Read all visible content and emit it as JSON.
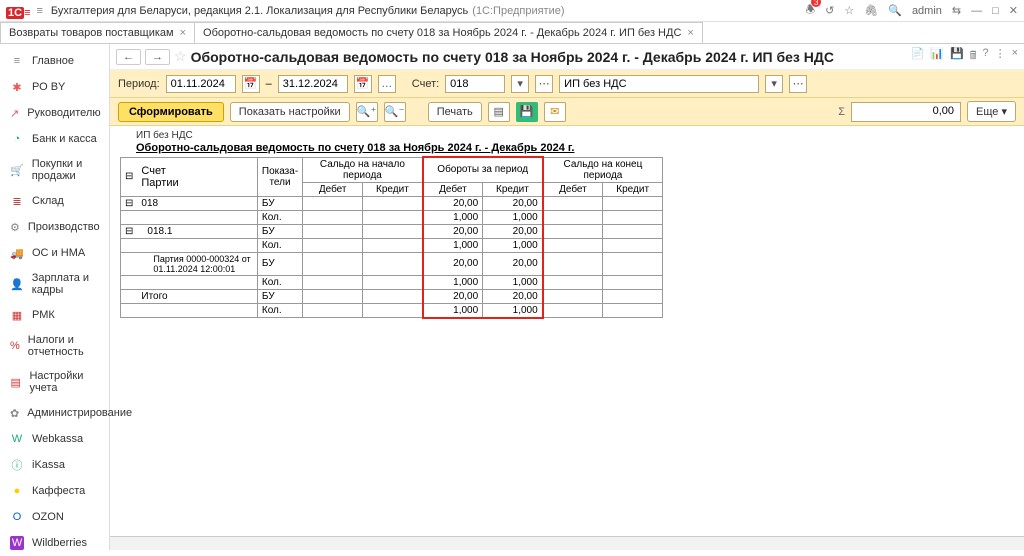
{
  "titlebar": {
    "logo": "1C",
    "app_title": "Бухгалтерия для Беларуси, редакция 2.1. Локализация для Республики Беларусь",
    "platform": "(1С:Предприятие)",
    "bell_badge": "3",
    "user": "admin"
  },
  "tabs": [
    {
      "label": "Возвраты товаров поставщикам"
    },
    {
      "label": "Оборотно-сальдовая ведомость по счету 018 за Ноябрь 2024 г. - Декабрь 2024 г. ИП без НДС"
    }
  ],
  "sidebar": [
    {
      "icon": "≡",
      "color": "#888",
      "label": "Главное"
    },
    {
      "icon": "✱",
      "color": "#e55",
      "label": "РО BY"
    },
    {
      "icon": "↗",
      "color": "#e55",
      "label": "Руководителю"
    },
    {
      "icon": "◔",
      "color": "#1a7",
      "label": "Банк и касса"
    },
    {
      "icon": "🛒",
      "color": "#b44",
      "label": "Покупки и продажи"
    },
    {
      "icon": "≣",
      "color": "#b44",
      "label": "Склад"
    },
    {
      "icon": "⚙",
      "color": "#888",
      "label": "Производство"
    },
    {
      "icon": "🚚",
      "color": "#888",
      "label": "ОС и НМА"
    },
    {
      "icon": "👤",
      "color": "#c90",
      "label": "Зарплата и кадры"
    },
    {
      "icon": "▦",
      "color": "#c33",
      "label": "РМК"
    },
    {
      "icon": "%",
      "color": "#c33",
      "label": "Налоги и отчетность"
    },
    {
      "icon": "▤",
      "color": "#c33",
      "label": "Настройки учета"
    },
    {
      "icon": "✿",
      "color": "#888",
      "label": "Администрирование"
    },
    {
      "icon": "W",
      "color": "#2a7",
      "label": "Webkassa"
    },
    {
      "icon": "ⓘ",
      "color": "#2a7",
      "label": "iKassa"
    },
    {
      "icon": "●",
      "color": "#fc0",
      "label": "Каффеста"
    },
    {
      "icon": "O",
      "color": "#06c",
      "label": "OZON"
    },
    {
      "icon": "W",
      "color": "#93c",
      "label": "Wildberries"
    }
  ],
  "nav": {
    "back": "←",
    "fwd": "→",
    "title": "Оборотно-сальдовая ведомость по счету 018 за Ноябрь 2024 г. - Декабрь 2024 г. ИП без НДС"
  },
  "params": {
    "period_lbl": "Период:",
    "from": "01.11.2024",
    "dash": "–",
    "to": "31.12.2024",
    "account_lbl": "Счет:",
    "account": "018",
    "org": "ИП без НДС"
  },
  "toolbar": {
    "form": "Сформировать",
    "settings": "Показать настройки",
    "print": "Печать",
    "sum_icon": "Σ",
    "sum_val": "0,00",
    "more": "Еще"
  },
  "report": {
    "org": "ИП без НДС",
    "title": "Оборотно-сальдовая ведомость по счету 018 за Ноябрь 2024 г. - Декабрь 2024 г.",
    "headers": {
      "acct": "Счет",
      "party": "Партии",
      "ind": "Показа-\nтели",
      "beg": "Сальдо на начало периода",
      "turn": "Обороты за период",
      "end": "Сальдо на конец периода",
      "dt": "Дебет",
      "kt": "Кредит"
    },
    "rows": [
      {
        "name": "018",
        "ind": "БУ",
        "td": "20,00",
        "tk": "20,00"
      },
      {
        "name": "",
        "ind": "Кол.",
        "td": "1,000",
        "tk": "1,000"
      },
      {
        "name": "018.1",
        "ind": "БУ",
        "td": "20,00",
        "tk": "20,00"
      },
      {
        "name": "",
        "ind": "Кол.",
        "td": "1,000",
        "tk": "1,000"
      },
      {
        "name": "Партия 0000-000324 от 01.11.2024 12:00:01",
        "ind": "БУ",
        "td": "20,00",
        "tk": "20,00"
      },
      {
        "name": "",
        "ind": "Кол.",
        "td": "1,000",
        "tk": "1,000"
      },
      {
        "name": "Итого",
        "ind": "БУ",
        "td": "20,00",
        "tk": "20,00"
      },
      {
        "name": "",
        "ind": "Кол.",
        "td": "1,000",
        "tk": "1,000"
      }
    ]
  }
}
